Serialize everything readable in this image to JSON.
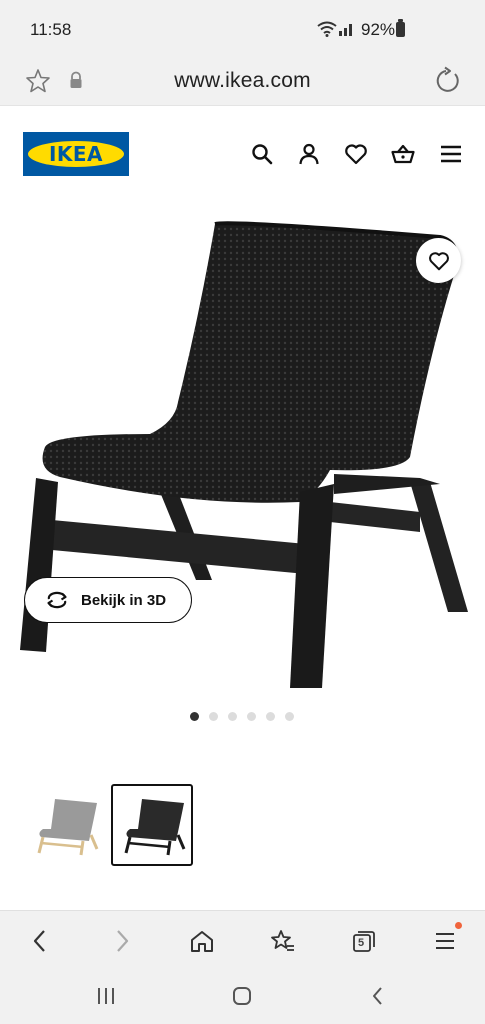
{
  "status_bar": {
    "time": "11:58",
    "battery": "92%"
  },
  "address_bar": {
    "url": "www.ikea.com"
  },
  "header": {
    "logo_text": "IKEA",
    "icons": [
      "search-icon",
      "account-icon",
      "wishlist-icon",
      "basket-icon",
      "menu-icon"
    ]
  },
  "product": {
    "view_3d_label": "Bekijk in 3D",
    "image_count": 6,
    "active_image": 1,
    "variants": [
      "birch-grey",
      "black"
    ],
    "selected_variant": "black"
  },
  "browser_toolbar": {
    "tabs_count": "5"
  },
  "colors": {
    "ikea_blue": "#0058a3",
    "ikea_yellow": "#ffdb00",
    "notification": "#f0643c"
  }
}
